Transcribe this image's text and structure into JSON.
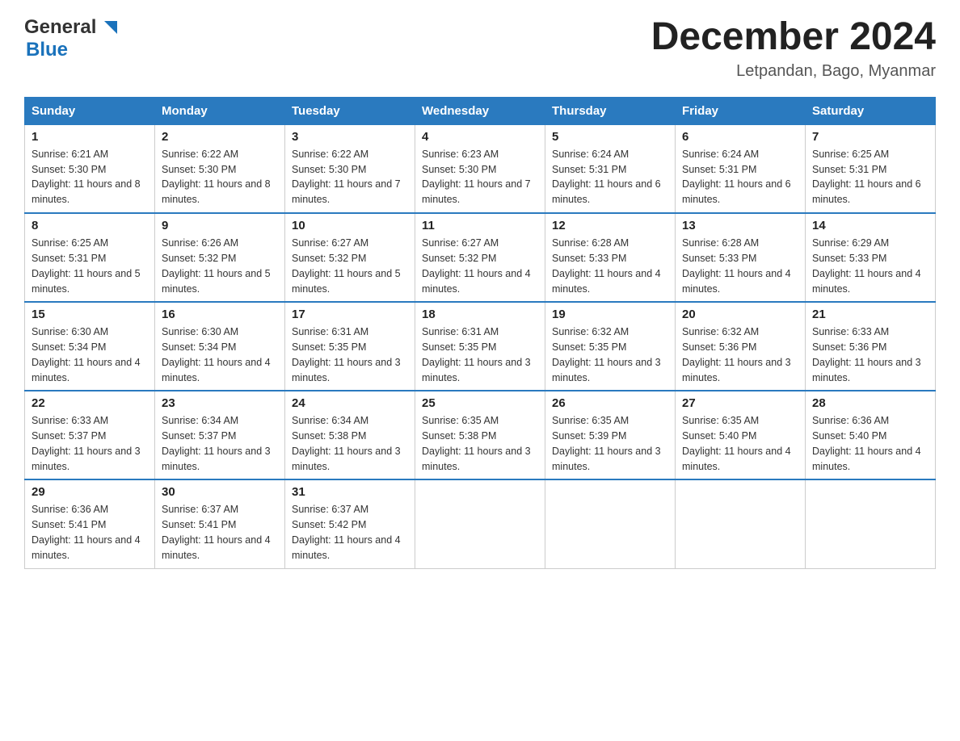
{
  "header": {
    "logo_general": "General",
    "logo_blue": "Blue",
    "month_year": "December 2024",
    "location": "Letpandan, Bago, Myanmar"
  },
  "columns": [
    "Sunday",
    "Monday",
    "Tuesday",
    "Wednesday",
    "Thursday",
    "Friday",
    "Saturday"
  ],
  "weeks": [
    [
      {
        "day": "1",
        "sunrise": "6:21 AM",
        "sunset": "5:30 PM",
        "daylight": "11 hours and 8 minutes."
      },
      {
        "day": "2",
        "sunrise": "6:22 AM",
        "sunset": "5:30 PM",
        "daylight": "11 hours and 8 minutes."
      },
      {
        "day": "3",
        "sunrise": "6:22 AM",
        "sunset": "5:30 PM",
        "daylight": "11 hours and 7 minutes."
      },
      {
        "day": "4",
        "sunrise": "6:23 AM",
        "sunset": "5:30 PM",
        "daylight": "11 hours and 7 minutes."
      },
      {
        "day": "5",
        "sunrise": "6:24 AM",
        "sunset": "5:31 PM",
        "daylight": "11 hours and 6 minutes."
      },
      {
        "day": "6",
        "sunrise": "6:24 AM",
        "sunset": "5:31 PM",
        "daylight": "11 hours and 6 minutes."
      },
      {
        "day": "7",
        "sunrise": "6:25 AM",
        "sunset": "5:31 PM",
        "daylight": "11 hours and 6 minutes."
      }
    ],
    [
      {
        "day": "8",
        "sunrise": "6:25 AM",
        "sunset": "5:31 PM",
        "daylight": "11 hours and 5 minutes."
      },
      {
        "day": "9",
        "sunrise": "6:26 AM",
        "sunset": "5:32 PM",
        "daylight": "11 hours and 5 minutes."
      },
      {
        "day": "10",
        "sunrise": "6:27 AM",
        "sunset": "5:32 PM",
        "daylight": "11 hours and 5 minutes."
      },
      {
        "day": "11",
        "sunrise": "6:27 AM",
        "sunset": "5:32 PM",
        "daylight": "11 hours and 4 minutes."
      },
      {
        "day": "12",
        "sunrise": "6:28 AM",
        "sunset": "5:33 PM",
        "daylight": "11 hours and 4 minutes."
      },
      {
        "day": "13",
        "sunrise": "6:28 AM",
        "sunset": "5:33 PM",
        "daylight": "11 hours and 4 minutes."
      },
      {
        "day": "14",
        "sunrise": "6:29 AM",
        "sunset": "5:33 PM",
        "daylight": "11 hours and 4 minutes."
      }
    ],
    [
      {
        "day": "15",
        "sunrise": "6:30 AM",
        "sunset": "5:34 PM",
        "daylight": "11 hours and 4 minutes."
      },
      {
        "day": "16",
        "sunrise": "6:30 AM",
        "sunset": "5:34 PM",
        "daylight": "11 hours and 4 minutes."
      },
      {
        "day": "17",
        "sunrise": "6:31 AM",
        "sunset": "5:35 PM",
        "daylight": "11 hours and 3 minutes."
      },
      {
        "day": "18",
        "sunrise": "6:31 AM",
        "sunset": "5:35 PM",
        "daylight": "11 hours and 3 minutes."
      },
      {
        "day": "19",
        "sunrise": "6:32 AM",
        "sunset": "5:35 PM",
        "daylight": "11 hours and 3 minutes."
      },
      {
        "day": "20",
        "sunrise": "6:32 AM",
        "sunset": "5:36 PM",
        "daylight": "11 hours and 3 minutes."
      },
      {
        "day": "21",
        "sunrise": "6:33 AM",
        "sunset": "5:36 PM",
        "daylight": "11 hours and 3 minutes."
      }
    ],
    [
      {
        "day": "22",
        "sunrise": "6:33 AM",
        "sunset": "5:37 PM",
        "daylight": "11 hours and 3 minutes."
      },
      {
        "day": "23",
        "sunrise": "6:34 AM",
        "sunset": "5:37 PM",
        "daylight": "11 hours and 3 minutes."
      },
      {
        "day": "24",
        "sunrise": "6:34 AM",
        "sunset": "5:38 PM",
        "daylight": "11 hours and 3 minutes."
      },
      {
        "day": "25",
        "sunrise": "6:35 AM",
        "sunset": "5:38 PM",
        "daylight": "11 hours and 3 minutes."
      },
      {
        "day": "26",
        "sunrise": "6:35 AM",
        "sunset": "5:39 PM",
        "daylight": "11 hours and 3 minutes."
      },
      {
        "day": "27",
        "sunrise": "6:35 AM",
        "sunset": "5:40 PM",
        "daylight": "11 hours and 4 minutes."
      },
      {
        "day": "28",
        "sunrise": "6:36 AM",
        "sunset": "5:40 PM",
        "daylight": "11 hours and 4 minutes."
      }
    ],
    [
      {
        "day": "29",
        "sunrise": "6:36 AM",
        "sunset": "5:41 PM",
        "daylight": "11 hours and 4 minutes."
      },
      {
        "day": "30",
        "sunrise": "6:37 AM",
        "sunset": "5:41 PM",
        "daylight": "11 hours and 4 minutes."
      },
      {
        "day": "31",
        "sunrise": "6:37 AM",
        "sunset": "5:42 PM",
        "daylight": "11 hours and 4 minutes."
      },
      null,
      null,
      null,
      null
    ]
  ],
  "labels": {
    "sunrise": "Sunrise:",
    "sunset": "Sunset:",
    "daylight": "Daylight:"
  }
}
